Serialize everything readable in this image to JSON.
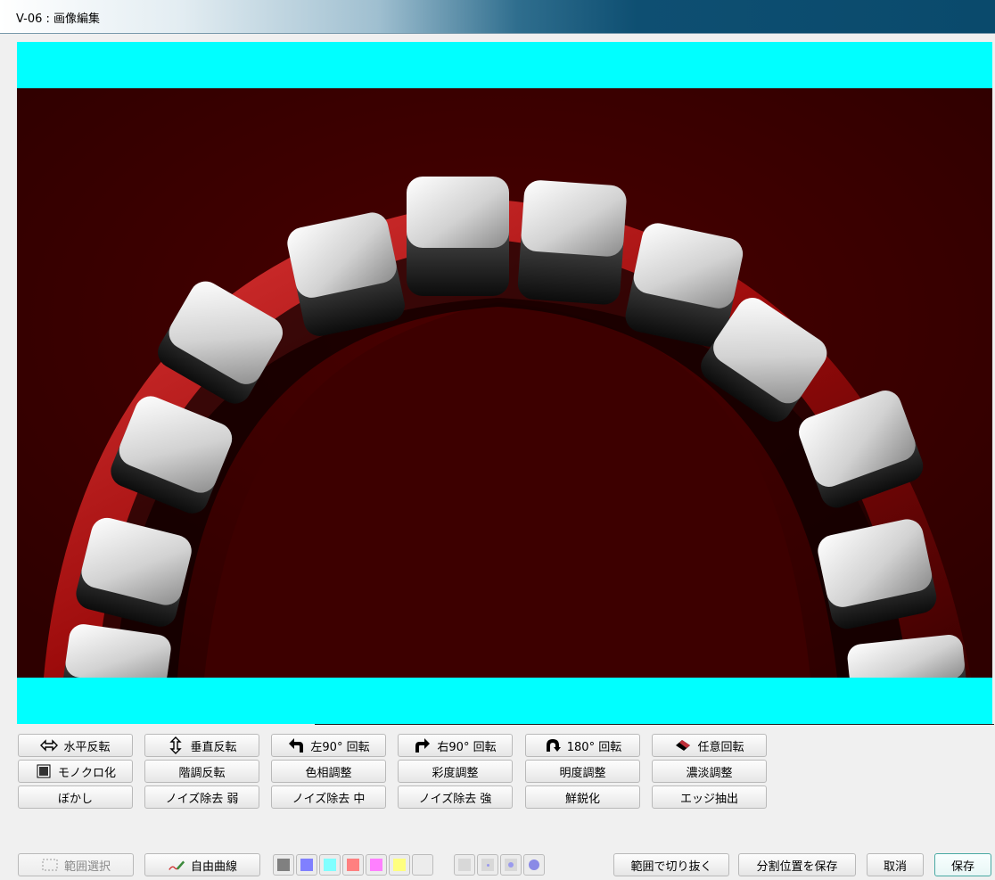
{
  "window": {
    "title": "V-06 : 画像編集"
  },
  "toolbar": {
    "row1": [
      {
        "label": "水平反転",
        "icon": "flip-horizontal-icon"
      },
      {
        "label": "垂直反転",
        "icon": "flip-vertical-icon"
      },
      {
        "label": "左90° 回転",
        "icon": "rotate-left-icon"
      },
      {
        "label": "右90° 回転",
        "icon": "rotate-right-icon"
      },
      {
        "label": "180° 回転",
        "icon": "rotate-180-icon"
      },
      {
        "label": "任意回転",
        "icon": "free-rotate-icon"
      }
    ],
    "row2": [
      {
        "label": "モノクロ化",
        "icon": "monochrome-icon"
      },
      {
        "label": "階調反転"
      },
      {
        "label": "色相調整"
      },
      {
        "label": "彩度調整"
      },
      {
        "label": "明度調整"
      },
      {
        "label": "濃淡調整"
      }
    ],
    "row3": [
      {
        "label": "ぼかし"
      },
      {
        "label": "ノイズ除去 弱"
      },
      {
        "label": "ノイズ除去 中"
      },
      {
        "label": "ノイズ除去 強"
      },
      {
        "label": "鮮鋭化"
      },
      {
        "label": "エッジ抽出"
      }
    ]
  },
  "bottom": {
    "range_select": "範囲選択",
    "free_curve": "自由曲線",
    "colors": [
      "#808080",
      "#8080ff",
      "#80ffff",
      "#ff8080",
      "#ff80ff",
      "#ffff80",
      "#ececec"
    ],
    "pen_sizes": [
      "small",
      "medium",
      "large",
      "x-large"
    ],
    "crop": "範囲で切り抜く",
    "save_split": "分割位置を保存",
    "cancel": "取消",
    "save": "保存"
  },
  "colors": {
    "canvas_border": "#00ffff",
    "photo_background": "#3c0000"
  }
}
